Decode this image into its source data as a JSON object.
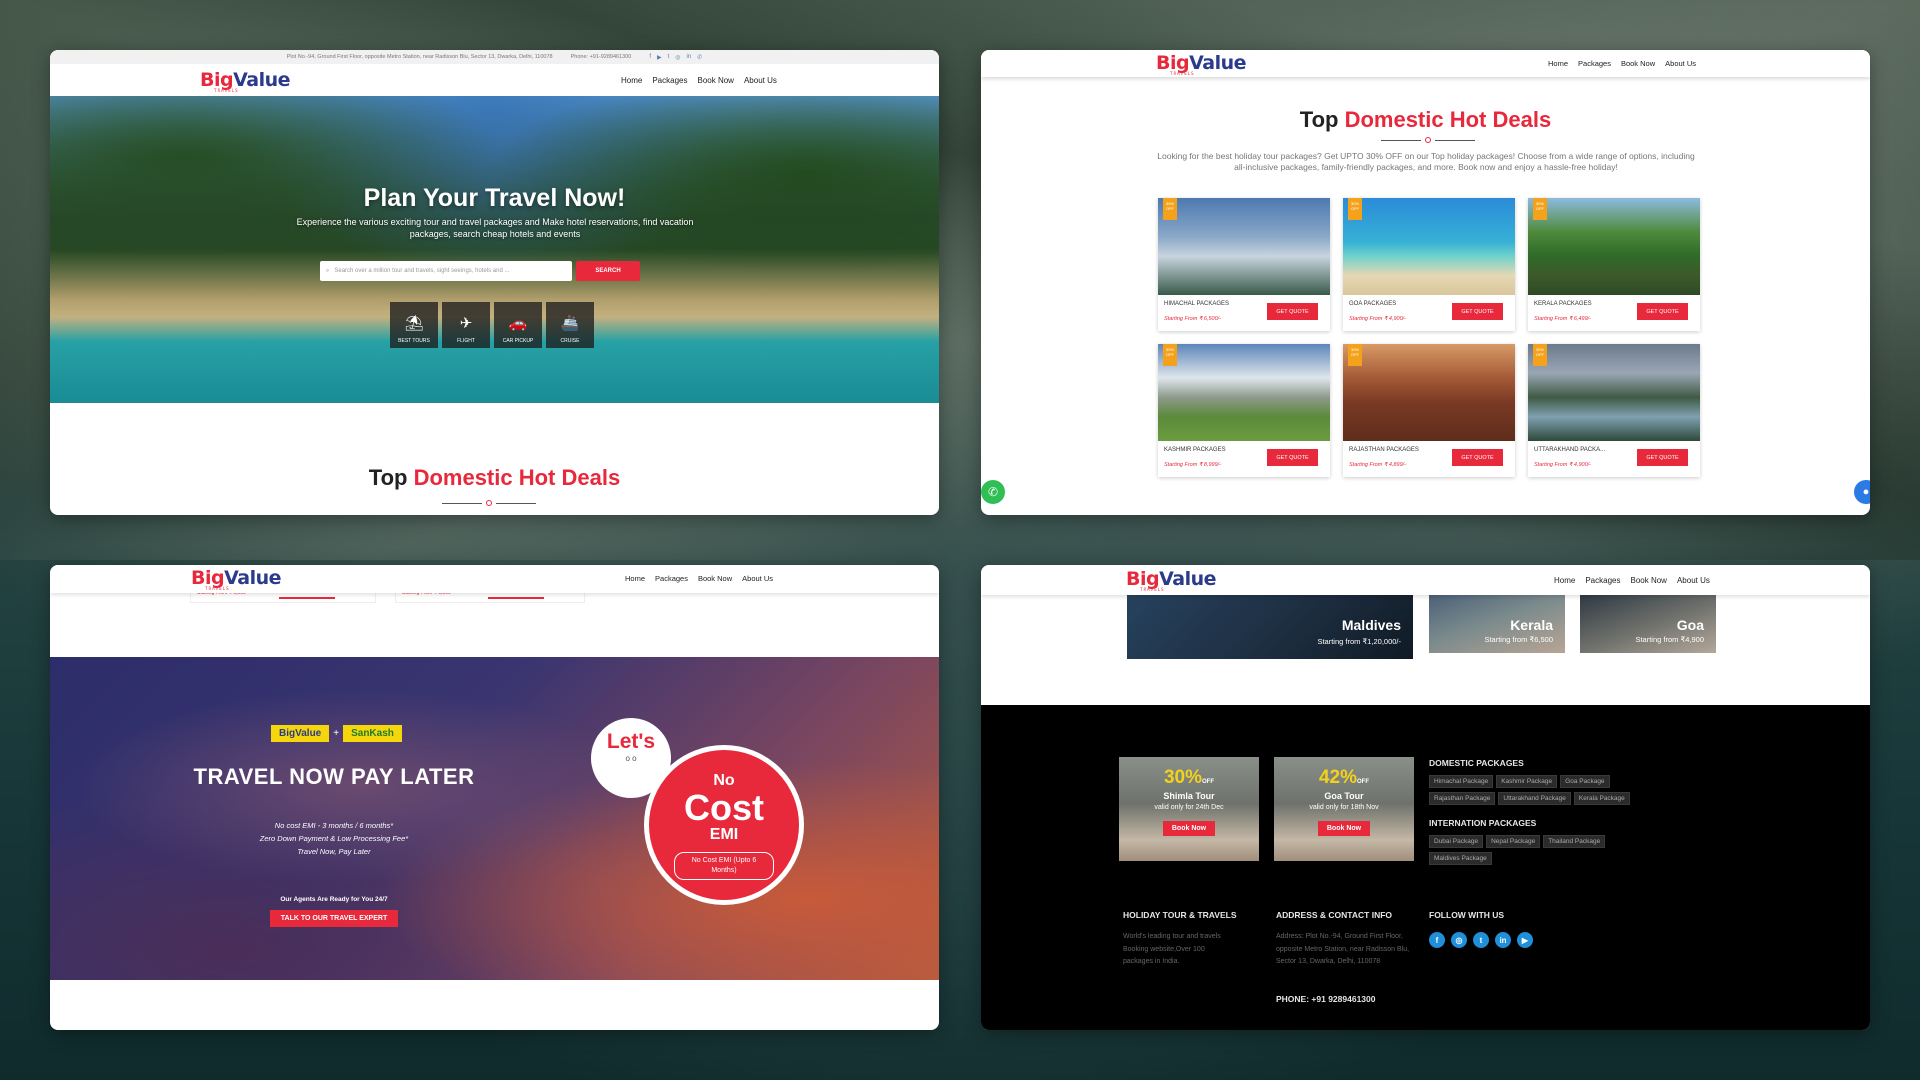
{
  "brand": {
    "logo_big": "Big",
    "logo_value": "Value",
    "logo_sub": "TRAVELS"
  },
  "nav": [
    "Home",
    "Packages",
    "Book Now",
    "About Us"
  ],
  "panel1": {
    "topbar_address": "Plot No.-94, Ground First Floor, opposite Metro Station, near Radisson Blu, Sector 13, Dwarka, Delhi, 110078",
    "topbar_phone": "Phone: +91-9289461300",
    "hero_title": "Plan Your Travel Now!",
    "hero_text": "Experience the various exciting tour and travel packages and Make hotel reservations, find vacation packages, search cheap hotels and events",
    "search_placeholder": "Search over a million tour and travels, sight seeings, hotels and ...",
    "search_button": "SEARCH",
    "categories": [
      {
        "label": "BEST TOURS",
        "icon": "beach-umbrella-icon",
        "glyph": "⛱"
      },
      {
        "label": "FLIGHT",
        "icon": "airplane-icon",
        "glyph": "✈"
      },
      {
        "label": "CAR PICKUP",
        "icon": "car-icon",
        "glyph": "🚗"
      },
      {
        "label": "CRUISE",
        "icon": "ship-icon",
        "glyph": "🚢"
      }
    ],
    "section_title_a": "Top ",
    "section_title_b": "Domestic Hot Deals"
  },
  "panel2": {
    "section_title_a": "Top ",
    "section_title_b": "Domestic Hot Deals",
    "description": "Looking for the best holiday tour packages? Get UPTO 30% OFF on our Top holiday packages! Choose from a wide range of options, including all-inclusive packages, family-friendly packages, and more. Book now and enjoy a hassle-free holiday!",
    "tag": "30% OFF",
    "get_quote": "GET QUOTE",
    "cards": [
      {
        "name": "HIMACHAL PACKAGES",
        "price": "Starting From ₹ 6,500/-"
      },
      {
        "name": "GOA PACKAGES",
        "price": "Starting From ₹ 4,900/-"
      },
      {
        "name": "KERALA PACKAGES",
        "price": "Starting From ₹ 6,499/-"
      },
      {
        "name": "KASHMIR PACKAGES",
        "price": "Starting From ₹ 8,999/-"
      },
      {
        "name": "RAJASTHAN PACKAGES",
        "price": "Starting From ₹ 4,899/-"
      },
      {
        "name": "UTTARAKHAND PACKA...",
        "price": "Starting From ₹ 4,900/-"
      }
    ]
  },
  "panel3": {
    "partner_a": "BigValue",
    "partner_plus": "+",
    "partner_b": "SanKash",
    "title": "TRAVEL NOW PAY LATER",
    "line1": "No cost EMI - 3 months / 6 months*",
    "line2": "Zero Down Payment & Low Processing Fee*",
    "line3": "Travel Now, Pay Later",
    "agents": "Our Agents Are Ready for You 24/7",
    "cta": "TALK TO OUR TRAVEL EXPERT",
    "lets": "Let's",
    "lets_dots": "o o",
    "no": "No",
    "cost": "Cost",
    "emi": "EMI",
    "emi_note": "No Cost EMI (Upto 6 Months)",
    "remnant_price": "Starting From ₹ 6,500"
  },
  "panel4": {
    "destinations": [
      {
        "name": "Maldives",
        "price": "Starting from ₹1,20,000/-"
      },
      {
        "name": "Kerala",
        "price": "Starting from ₹6,500"
      },
      {
        "name": "Goa",
        "price": "Starting from ₹4,900"
      }
    ],
    "promos": [
      {
        "pct": "30%",
        "off": "OFF",
        "title": "Shimla Tour",
        "valid": "valid only for 24th Dec",
        "button": "Book Now"
      },
      {
        "pct": "42%",
        "off": "OFF",
        "title": "Goa Tour",
        "valid": "valid only for 18th Nov",
        "button": "Book Now"
      }
    ],
    "domestic_heading": "DOMESTIC PACKAGES",
    "domestic": [
      "Himachal Package",
      "Kashmir Package",
      "Goa Package",
      "Rajasthan Package",
      "Uttarakhand Package",
      "Kerala Package"
    ],
    "international_heading": "INTERNATION PACKAGES",
    "international": [
      "Dubai Package",
      "Nepal Package",
      "Thailand Package",
      "Maldives Package"
    ],
    "col1_heading": "HOLIDAY TOUR & TRAVELS",
    "col1_text": "World's leading tour and travels Booking website,Over 100 packages in India.",
    "col2_heading": "ADDRESS & CONTACT INFO",
    "col2_text": "Address: Plot No.-94, Ground First Floor, opposite Metro Station, near Radisson Blu, Sector 13, Dwarka, Delhi, 110078",
    "phone": "PHONE: +91 9289461300",
    "col3_heading": "FOLLOW WITH US",
    "social": [
      {
        "name": "facebook-icon",
        "glyph": "f"
      },
      {
        "name": "instagram-icon",
        "glyph": "◎"
      },
      {
        "name": "twitter-icon",
        "glyph": "t"
      },
      {
        "name": "linkedin-icon",
        "glyph": "in"
      },
      {
        "name": "youtube-icon",
        "glyph": "▶"
      }
    ]
  },
  "colors": {
    "accent": "#e8283b",
    "brand_blue": "#2b3a8c",
    "promo_yellow": "#f2d21b",
    "whatsapp": "#2fbf55"
  }
}
